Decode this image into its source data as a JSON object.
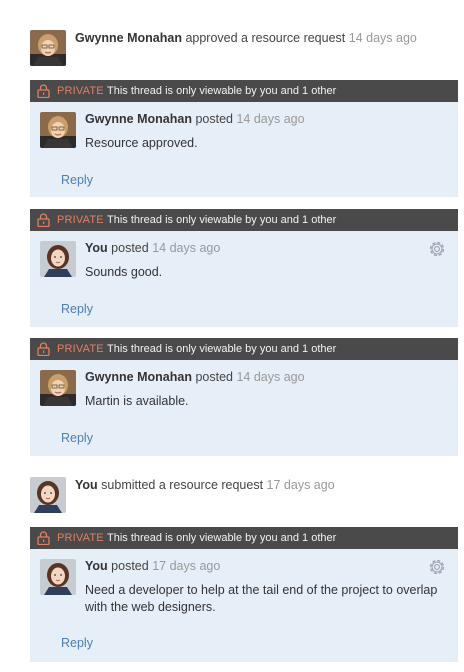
{
  "colors": {
    "private_label": "#e57e5e",
    "link": "#4a7fb8",
    "panel_bg": "#e6eef8",
    "bar_bg": "#4a4a4a"
  },
  "feed": {
    "event1": {
      "actor": "Gwynne Monahan",
      "action": "approved a resource request",
      "time": "14 days ago"
    },
    "thread1": {
      "private_label": "PRIVATE",
      "notice": "This thread is only viewable by you and 1 other",
      "author": "Gwynne Monahan",
      "verb": "posted",
      "time": "14 days ago",
      "body": "Resource approved.",
      "reply": "Reply"
    },
    "thread2": {
      "private_label": "PRIVATE",
      "notice": "This thread is only viewable by you and 1 other",
      "author": "You",
      "verb": "posted",
      "time": "14 days ago",
      "body": "Sounds good.",
      "reply": "Reply"
    },
    "thread3": {
      "private_label": "PRIVATE",
      "notice": "This thread is only viewable by you and 1 other",
      "author": "Gwynne Monahan",
      "verb": "posted",
      "time": "14 days ago",
      "body": "Martin is available.",
      "reply": "Reply"
    },
    "event2": {
      "actor": "You",
      "action": "submitted a resource request",
      "time": "17 days ago"
    },
    "thread4": {
      "private_label": "PRIVATE",
      "notice": "This thread is only viewable by you and 1 other",
      "author": "You",
      "verb": "posted",
      "time": "17 days ago",
      "body": "Need a developer to help at the tail end of the project to overlap with the web designers.",
      "reply": "Reply"
    }
  }
}
